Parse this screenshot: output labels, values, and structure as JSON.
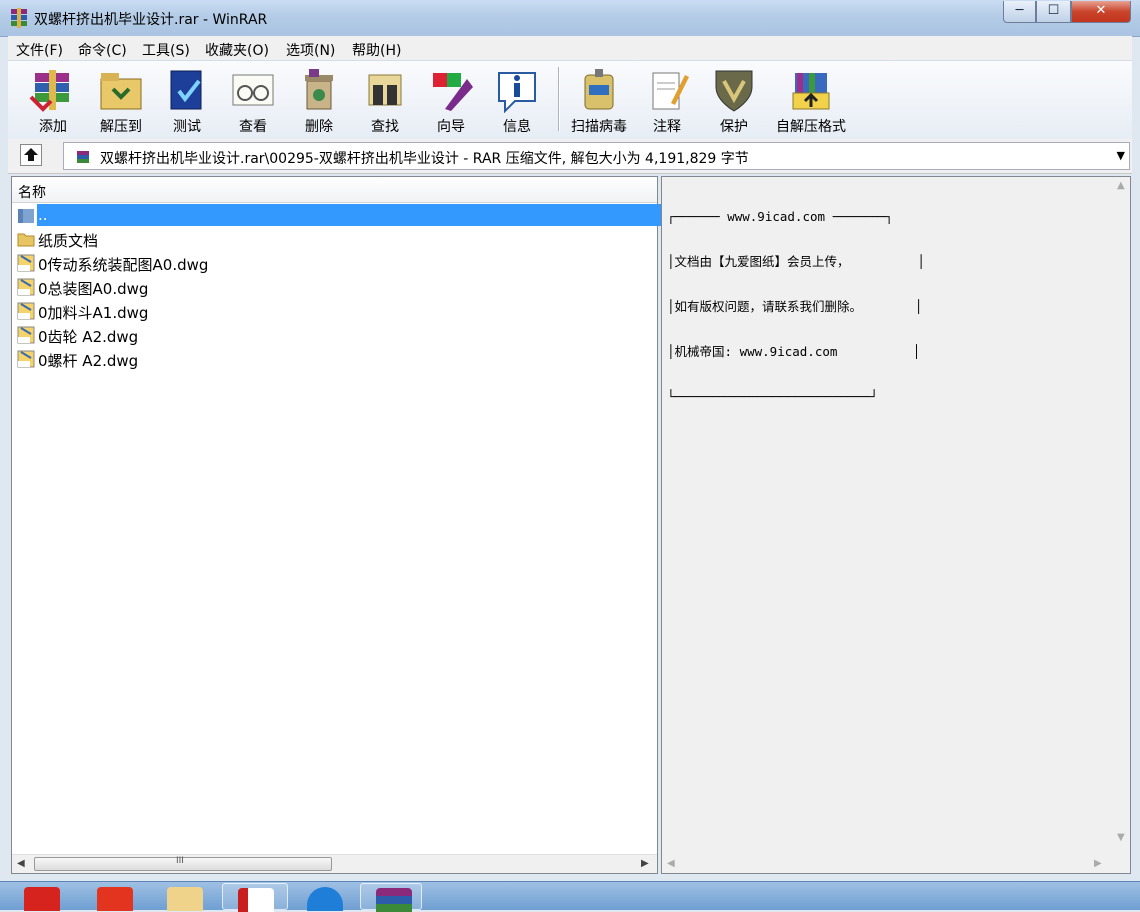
{
  "window": {
    "title": "双螺杆挤出机毕业设计.rar - WinRAR",
    "minimize": "─",
    "maximize": "☐",
    "close": "✕"
  },
  "menu": [
    "文件(F)",
    "命令(C)",
    "工具(S)",
    "收藏夹(O)",
    "选项(N)",
    "帮助(H)"
  ],
  "toolbar": {
    "add": "添加",
    "extract": "解压到",
    "test": "测试",
    "view": "查看",
    "delete": "删除",
    "find": "查找",
    "wizard": "向导",
    "info": "信息",
    "scan": "扫描病毒",
    "comment": "注释",
    "protect": "保护",
    "sfx": "自解压格式"
  },
  "address": {
    "path": "双螺杆挤出机毕业设计.rar\\00295-双螺杆挤出机毕业设计 - RAR 压缩文件, 解包大小为 4,191,829 字节"
  },
  "filelist": {
    "column_name": "名称",
    "items": [
      {
        "name": "..",
        "type": "parent-folder"
      },
      {
        "name": "纸质文档",
        "type": "folder"
      },
      {
        "name": "0传动系统装配图A0.dwg",
        "type": "dwg"
      },
      {
        "name": "0总装图A0.dwg",
        "type": "dwg"
      },
      {
        "name": "0加料斗A1.dwg",
        "type": "dwg"
      },
      {
        "name": "0齿轮 A2.dwg",
        "type": "dwg"
      },
      {
        "name": "0螺杆 A2.dwg",
        "type": "dwg"
      }
    ],
    "scroll_grip": "III"
  },
  "comment": {
    "line1": "┌────── www.9icad.com ───────┐",
    "line2": "│文档由【九爱图纸】会员上传，         │",
    "line3": "│如有版权问题，请联系我们删除。       │",
    "line4": "│机械帝国: www.9icad.com          │",
    "line5": "└──────────────────────────┘"
  },
  "taskbar": {
    "apps": [
      "solidworks-icon",
      "app-red-icon",
      "explorer-folder-icon",
      "autocad-icon",
      "browser-icon",
      "winrar-icon"
    ]
  },
  "colors": {
    "selection": "#3399ff",
    "titlebar": "#b3cbe6",
    "close_button": "#c9452c"
  }
}
